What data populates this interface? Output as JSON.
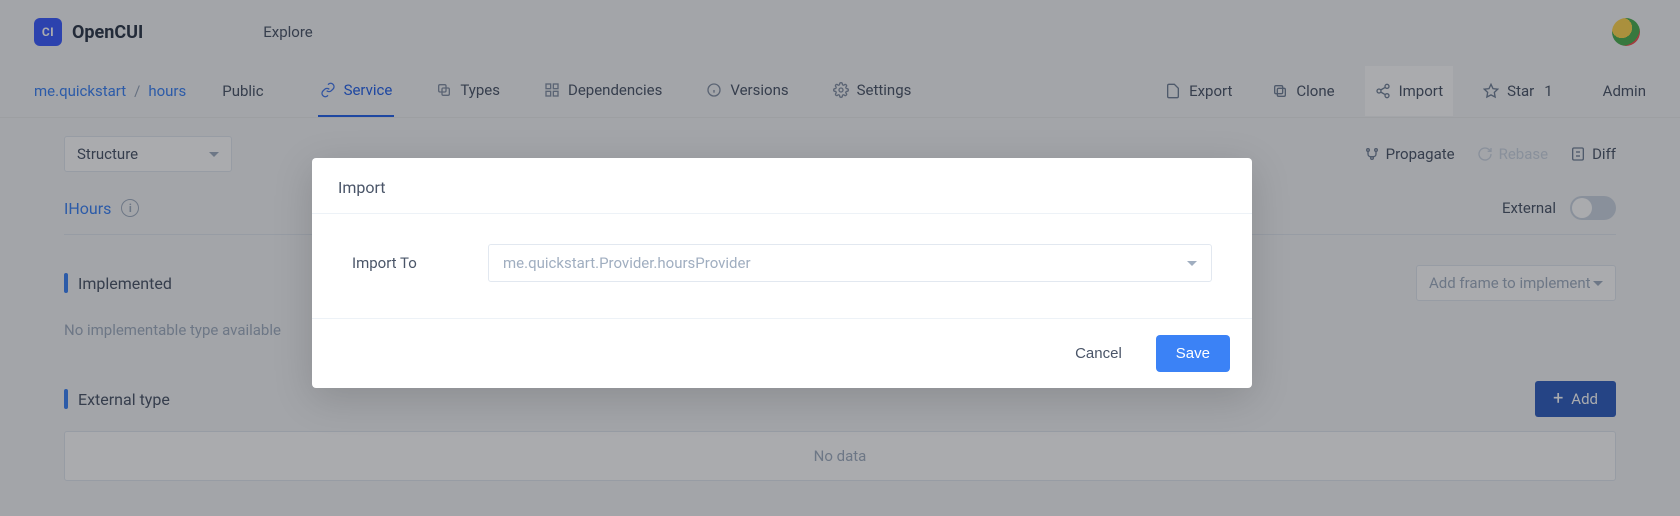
{
  "header": {
    "brand": "OpenCUI",
    "logo_text": "CI",
    "explore": "Explore"
  },
  "breadcrumb": {
    "org": "me.quickstart",
    "project": "hours",
    "visibility": "Public"
  },
  "tabs": {
    "service": "Service",
    "types": "Types",
    "dependencies": "Dependencies",
    "versions": "Versions",
    "settings": "Settings"
  },
  "nav_actions": {
    "export": "Export",
    "clone": "Clone",
    "import": "Import",
    "star": "Star",
    "star_count": "1",
    "admin": "Admin"
  },
  "toolbar": {
    "structure_label": "Structure",
    "propagate": "Propagate",
    "rebase": "Rebase",
    "diff": "Diff"
  },
  "ihours": {
    "label": "IHours",
    "external_label": "External"
  },
  "sections": {
    "implemented": "Implemented",
    "implemented_empty": "No implementable type available",
    "external_type": "External type",
    "add_frame_placeholder": "Add frame to implement",
    "add_button": "Add",
    "no_data": "No data"
  },
  "modal": {
    "title": "Import",
    "label": "Import To",
    "value": "me.quickstart.Provider.hoursProvider",
    "cancel": "Cancel",
    "save": "Save"
  }
}
